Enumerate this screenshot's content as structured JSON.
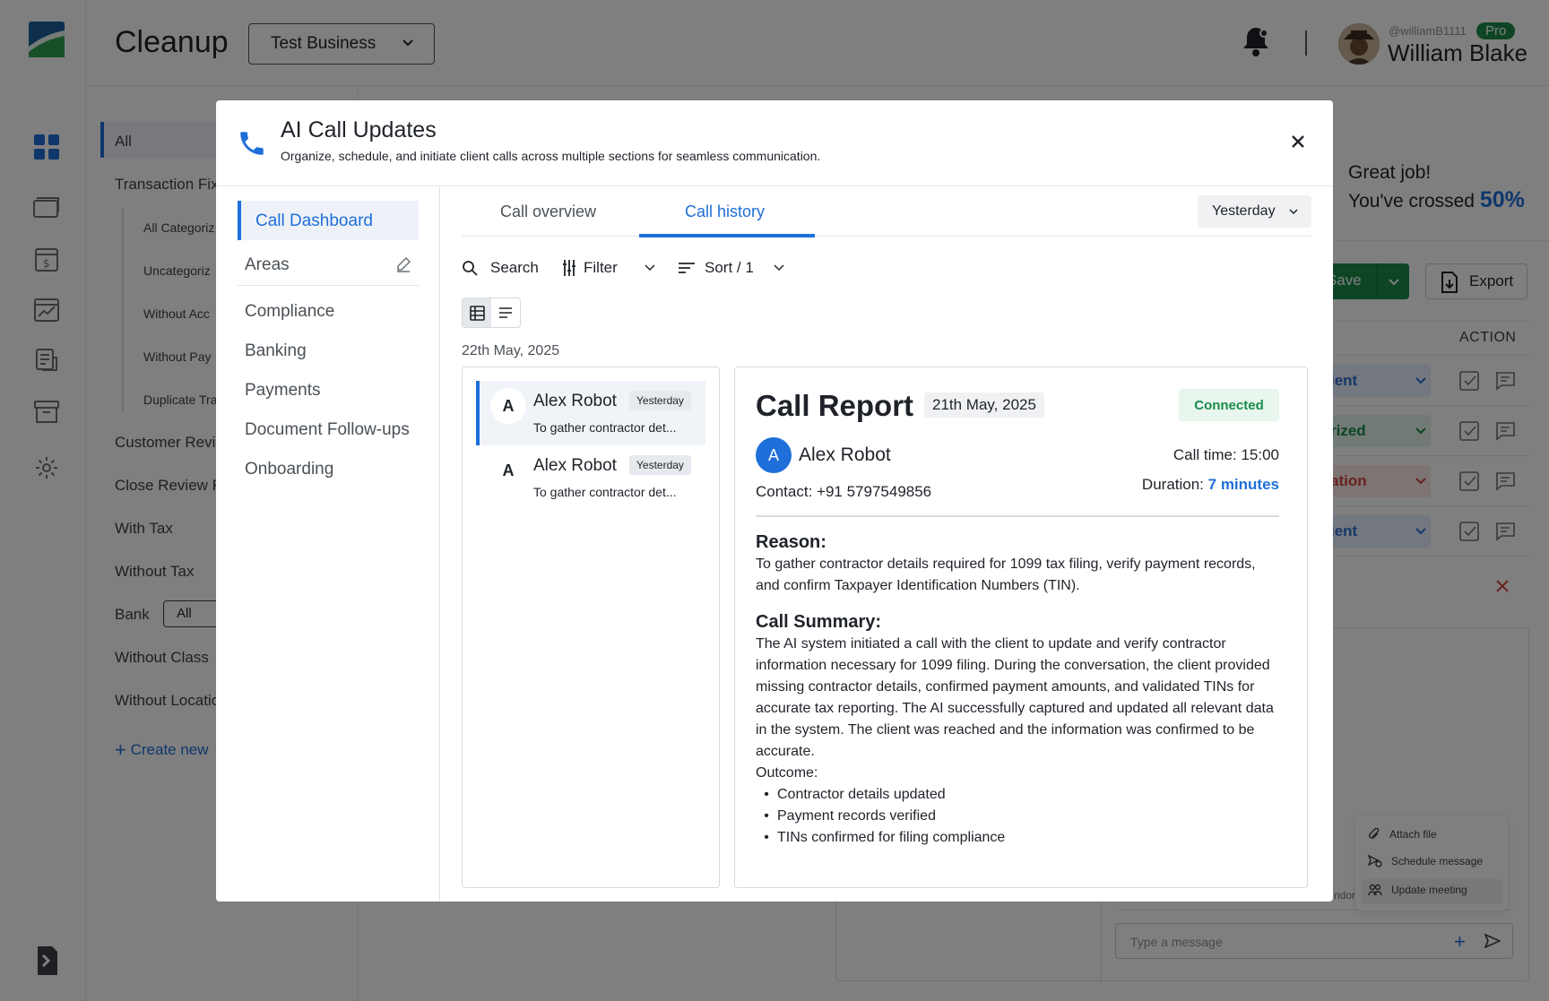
{
  "app": {
    "page_title": "Cleanup",
    "business_select": "Test Business",
    "user": {
      "handle": "@williamB1111",
      "badge": "Pro",
      "name": "William Blake"
    }
  },
  "sidebar_filters": {
    "items": [
      {
        "label": "All"
      },
      {
        "label": "Transaction Fix"
      },
      {
        "label": "All Categoriz"
      },
      {
        "label": "Uncategoriz"
      },
      {
        "label": "Without Acc"
      },
      {
        "label": "Without Pay"
      },
      {
        "label": "Duplicate Tra"
      },
      {
        "label": "Customer Revi"
      },
      {
        "label": "Close Review F"
      },
      {
        "label": "With Tax"
      },
      {
        "label": "Without Tax"
      },
      {
        "label": "Bank"
      },
      {
        "label": "Without Class"
      },
      {
        "label": "Without Locatio"
      }
    ],
    "bank_select": "All",
    "create_new": "Create new"
  },
  "background": {
    "great_job": "Great job!",
    "crossed_prefix": "You've crossed",
    "crossed_percent": "50%",
    "save_label": "Save",
    "export_label": "Export",
    "action_header": "ACTION",
    "rows": [
      {
        "status": "ient",
        "color": "#2f6fd1",
        "bg": "#e6efff"
      },
      {
        "status": "rized",
        "color": "#1a8b4a",
        "bg": "#e5f5ea"
      },
      {
        "status": "ation",
        "color": "#d0453a",
        "bg": "#fde9e7"
      },
      {
        "status": "ient",
        "color": "#2f6fd1",
        "bg": "#e6efff"
      }
    ],
    "message_placeholder": "Type a message",
    "vendor_fragment": "ndor",
    "menu": [
      {
        "label": "Attach file"
      },
      {
        "label": "Schedule message"
      },
      {
        "label": "Update meeting"
      }
    ]
  },
  "modal": {
    "title": "AI Call Updates",
    "subtitle": "Organize, schedule, and initiate client calls across multiple sections for seamless communication.",
    "nav": {
      "active": "Call Dashboard",
      "areas": "Areas",
      "items": [
        "Compliance",
        "Banking",
        "Payments",
        "Document Follow-ups",
        "Onboarding"
      ]
    },
    "tabs": {
      "overview": "Call overview",
      "history": "Call history"
    },
    "date_filter": "Yesterday",
    "toolbar": {
      "search": "Search",
      "filter": "Filter",
      "sort": "Sort / 1"
    },
    "list_date": "22th May, 2025",
    "calls": [
      {
        "avatar": "A",
        "name": "Alex Robot",
        "badge": "Yesterday",
        "desc": "To gather contractor det..."
      },
      {
        "avatar": "A",
        "name": "Alex Robot",
        "badge": "Yesterday",
        "desc": "To gather contractor det..."
      }
    ],
    "report": {
      "title": "Call Report",
      "date": "21th May, 2025",
      "status": "Connected",
      "avatar": "A",
      "name": "Alex Robot",
      "contact": "Contact: +91 5797549856",
      "call_time": "Call time: 15:00",
      "duration_label": "Duration:",
      "duration_value": "7 minutes",
      "reason_heading": "Reason:",
      "reason_text": "To gather contractor details required for 1099 tax filing, verify payment records, and confirm Taxpayer Identification Numbers (TIN).",
      "summary_heading": "Call Summary:",
      "summary_text": "The AI system initiated a call with the client to update and verify contractor information necessary for 1099 filing. During the conversation, the client provided missing contractor details, confirmed payment amounts, and validated TINs for accurate tax reporting. The AI successfully captured and updated all relevant data in the system. The client was reached and the information was confirmed to be accurate.",
      "outcome_label": "Outcome:",
      "outcomes": [
        "Contractor details updated",
        "Payment records verified",
        "TINs confirmed for filing compliance"
      ]
    }
  },
  "colors": {
    "accent": "#1e6fd9",
    "success": "#1a8b4a"
  }
}
